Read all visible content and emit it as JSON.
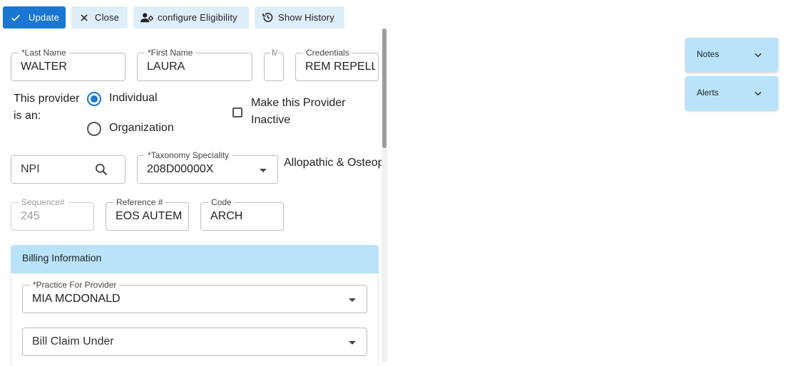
{
  "toolbar": {
    "update_label": "Update",
    "close_label": "Close",
    "configure_label": "configure Eligibility",
    "history_label": "Show History"
  },
  "fields": {
    "last_name": {
      "label": "*Last Name",
      "value": "WALTER"
    },
    "first_name": {
      "label": "*First Name",
      "value": "LAURA"
    },
    "middle_initial": {
      "label": "M",
      "value": ""
    },
    "credentials": {
      "label": "Credentials",
      "value": "REM REPELL"
    },
    "npi": {
      "placeholder": "NPI"
    },
    "taxonomy": {
      "label": "*Taxonomy Speciality",
      "value": "208D00000X",
      "description": "Allopathic & Osteop"
    },
    "sequence": {
      "label": "Sequence#",
      "value": "245"
    },
    "reference": {
      "label": "Reference #",
      "value": "EOS AUTEM"
    },
    "code": {
      "label": "Code",
      "value": "ARCH"
    }
  },
  "provider_type": {
    "label_line1": "This provider",
    "label_line2": "is an:",
    "options": [
      "Individual",
      "Organization"
    ],
    "selected": "Individual"
  },
  "inactive": {
    "label_line1": "Make this Provider",
    "label_line2": "Inactive",
    "checked": false
  },
  "billing": {
    "header": "Billing Information",
    "practice": {
      "label": "*Practice For Provider",
      "value": "MIA MCDONALD"
    },
    "bill_claim_under": {
      "placeholder": "Bill Claim Under"
    }
  },
  "side_panels": {
    "notes_label": "Notes",
    "alerts_label": "Alerts"
  },
  "colors": {
    "primary": "#1976d2",
    "light_button": "#ddeef9",
    "section_header": "#b8e3fa"
  }
}
